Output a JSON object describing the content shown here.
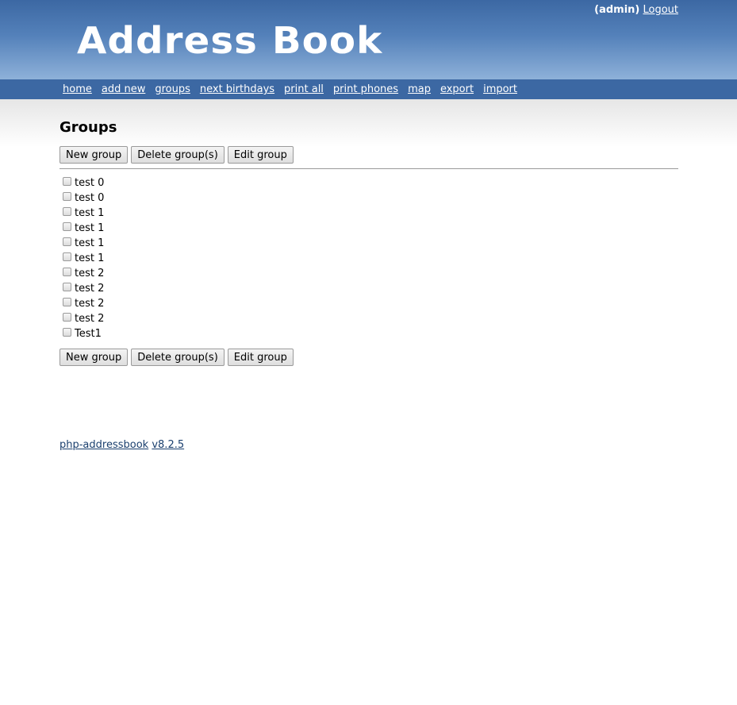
{
  "header": {
    "user": "(admin)",
    "logout": "Logout",
    "logo": "Address Book"
  },
  "nav": {
    "items": [
      "home",
      "add new",
      "groups",
      "next birthdays",
      "print all",
      "print phones",
      "map",
      "export",
      "import"
    ]
  },
  "page": {
    "title": "Groups"
  },
  "buttons": {
    "new_group": "New group",
    "delete_groups": "Delete group(s)",
    "edit_group": "Edit group"
  },
  "groups": [
    {
      "label": "test 0",
      "checked": false
    },
    {
      "label": "test 0",
      "checked": false
    },
    {
      "label": "test 1",
      "checked": false
    },
    {
      "label": "test 1",
      "checked": false
    },
    {
      "label": "test 1",
      "checked": false
    },
    {
      "label": "test 1",
      "checked": false
    },
    {
      "label": "test 2",
      "checked": false
    },
    {
      "label": "test 2",
      "checked": false
    },
    {
      "label": "test 2",
      "checked": false
    },
    {
      "label": "test 2",
      "checked": false
    },
    {
      "label": "Test1",
      "checked": false
    }
  ],
  "footer": {
    "app_link": "php-addressbook",
    "version_link": "v8.2.5"
  },
  "colors": {
    "header_top": "#3c68a3",
    "header_bottom": "#8eb1d9",
    "nav_bg": "#3c68a3",
    "footer_link": "#1a3f6e"
  }
}
